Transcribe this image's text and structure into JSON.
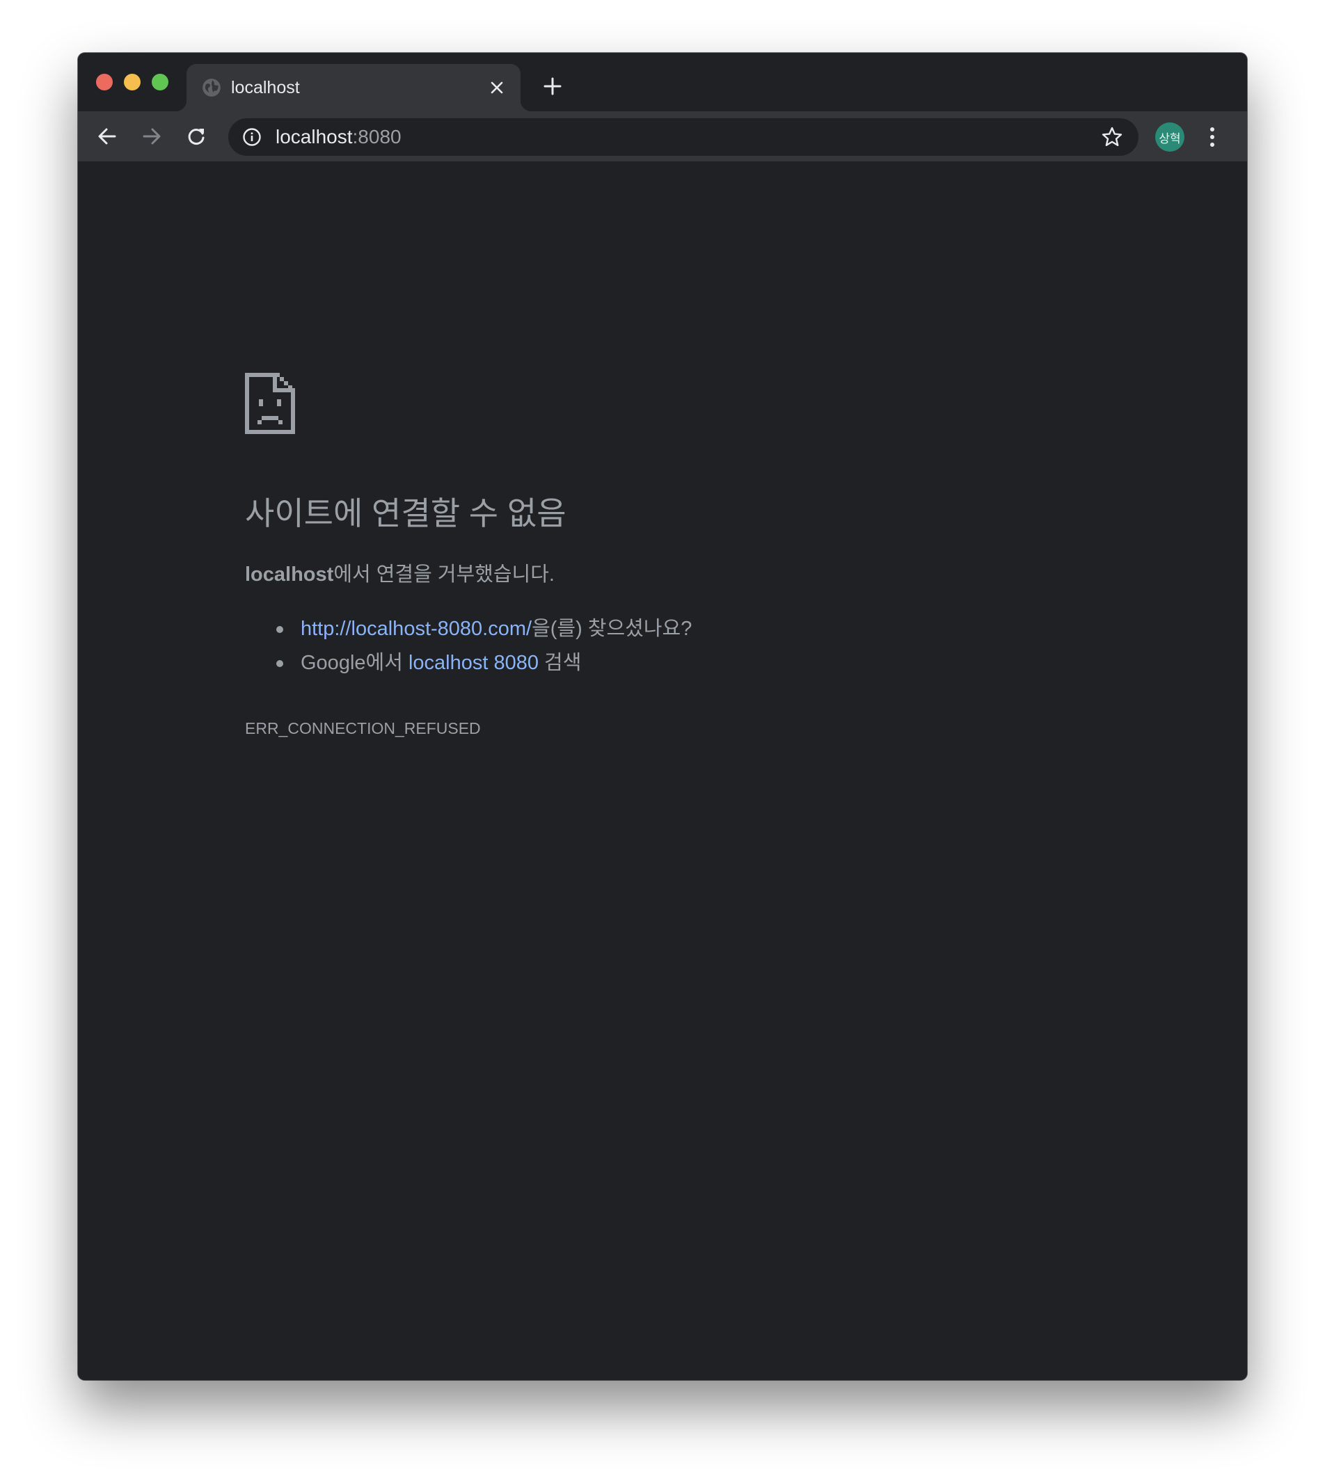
{
  "browser": {
    "tab": {
      "title": "localhost"
    },
    "omnibox": {
      "host": "localhost",
      "port": ":8080"
    },
    "profile": {
      "initials": "상혁",
      "color": "#2a8a76"
    }
  },
  "error_page": {
    "title": "사이트에 연결할 수 없음",
    "description": {
      "host": "localhost",
      "text": "에서 연결을 거부했습니다."
    },
    "suggestions": [
      {
        "link_text": "http://localhost-8080.com/",
        "suffix": "을(를) 찾으셨나요?"
      },
      {
        "prefix": "Google에서 ",
        "link_text": "localhost 8080",
        "suffix": " 검색"
      }
    ],
    "error_code": "ERR_CONNECTION_REFUSED"
  },
  "colors": {
    "page_background": "#202124",
    "toolbar": "#35363a",
    "text": "#9aa0a6",
    "link": "#8ab4f8"
  },
  "icons": {
    "tab_favicon": "globe-icon",
    "error_illustration": "sad-file-icon"
  }
}
